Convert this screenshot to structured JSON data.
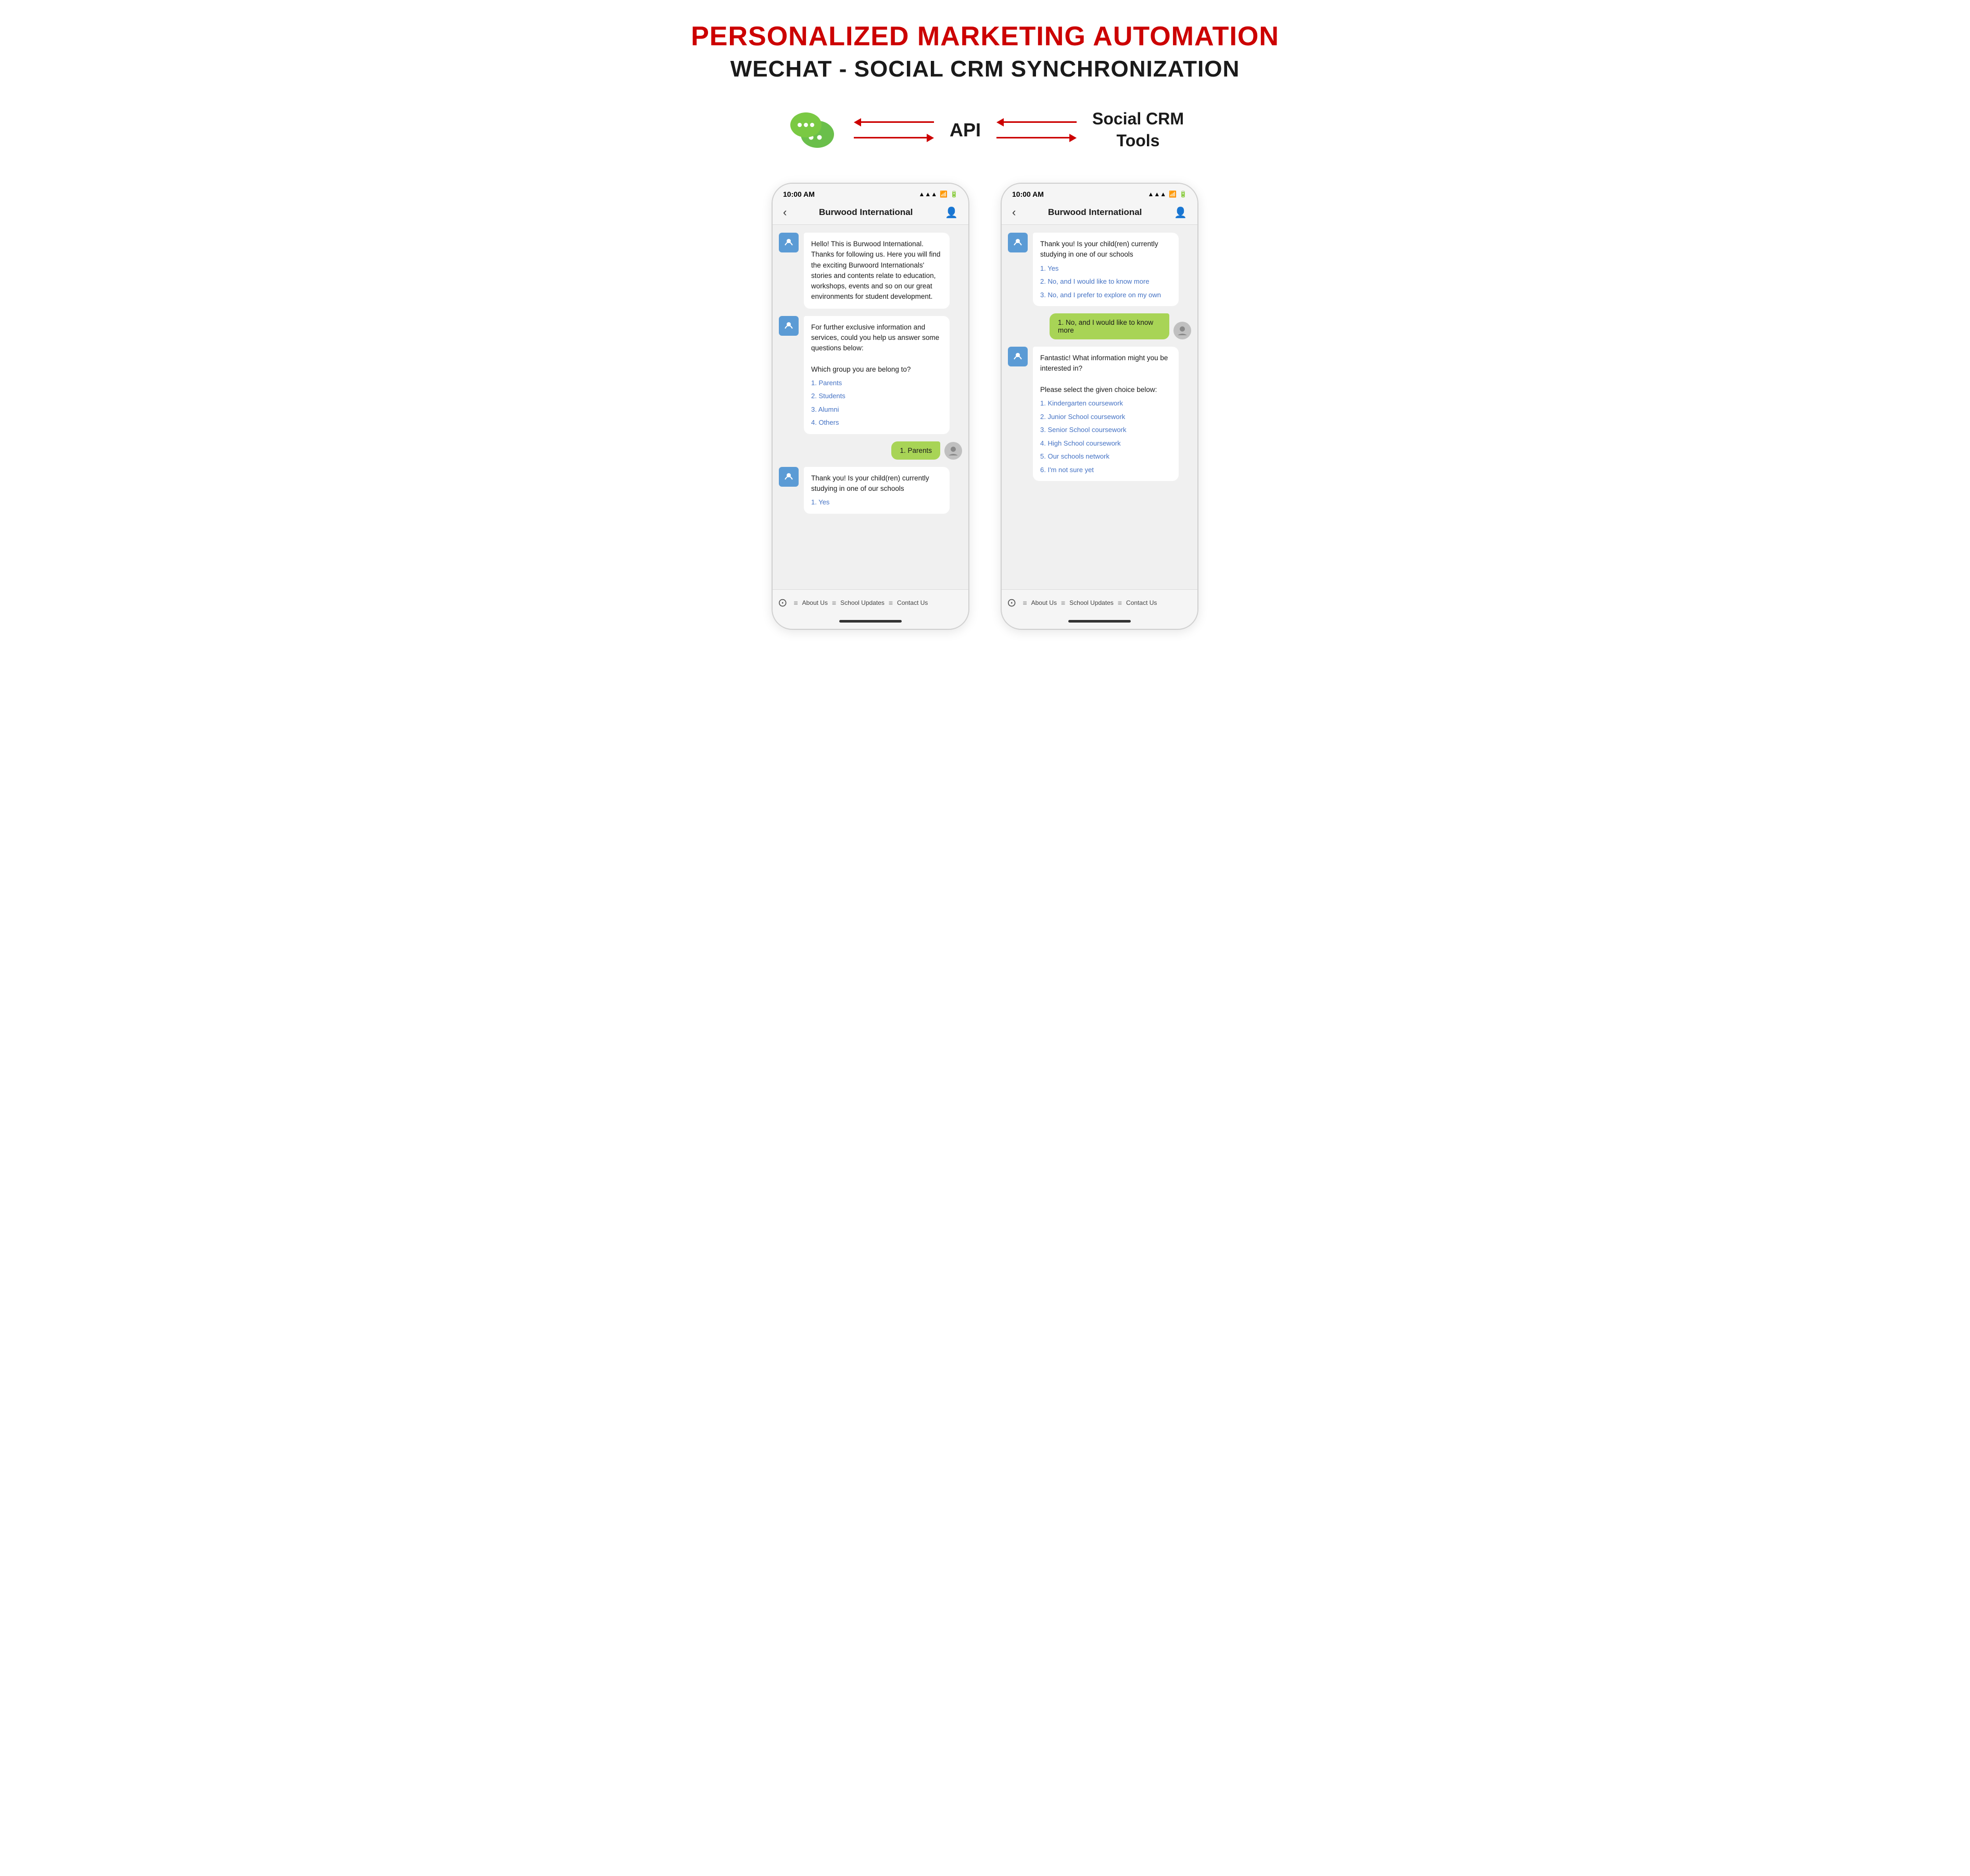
{
  "header": {
    "title1": "PERSONALIZED MARKETING AUTOMATION",
    "title2": "WECHAT - SOCIAL CRM SYNCHRONIZATION"
  },
  "diagram": {
    "api_label": "API",
    "social_crm_label": "Social CRM\nTools"
  },
  "phone1": {
    "status_time": "10:00 AM",
    "nav_title": "Burwood International",
    "messages": [
      {
        "type": "bot",
        "text": "Hello! This is Burwood International. Thanks for following us. Here you will find the exciting Burwood Internationals' stories and contents relate to education, workshops, events and so on our great environments for student development."
      },
      {
        "type": "bot",
        "text": "For further exclusive information and services, could you help us answer some questions below:\n\nWhich group you are belong to?",
        "options": [
          "1. Parents",
          "2. Students",
          "3. Alumni",
          "4. Others"
        ]
      },
      {
        "type": "user",
        "text": "1.  Parents"
      },
      {
        "type": "bot",
        "text": "Thank you! Is your child(ren) currently studying in one of our schools",
        "options": [
          "1. Yes"
        ]
      }
    ],
    "bottom_menu": {
      "menu_items": [
        "About Us",
        "School Updates",
        "Contact Us"
      ]
    }
  },
  "phone2": {
    "status_time": "10:00 AM",
    "nav_title": "Burwood International",
    "messages": [
      {
        "type": "bot",
        "text": "Thank you! Is your child(ren) currently studying in one of our schools",
        "options": [
          "1. Yes",
          "2. No, and I would like to know more",
          "3. No, and I prefer to explore on my own"
        ]
      },
      {
        "type": "user",
        "text": "1. No, and I would like to know more"
      },
      {
        "type": "bot",
        "text": "Fantastic! What information might you be interested in?\n\nPlease select the given choice below:",
        "options": [
          "1. Kindergarten coursework",
          "2. Junior School coursework",
          "3. Senior School coursework",
          "4. High School coursework",
          "5. Our schools network",
          "6. I'm not sure yet"
        ]
      }
    ],
    "bottom_menu": {
      "menu_items": [
        "About Us",
        "School Updates",
        "Contact Us"
      ]
    }
  }
}
